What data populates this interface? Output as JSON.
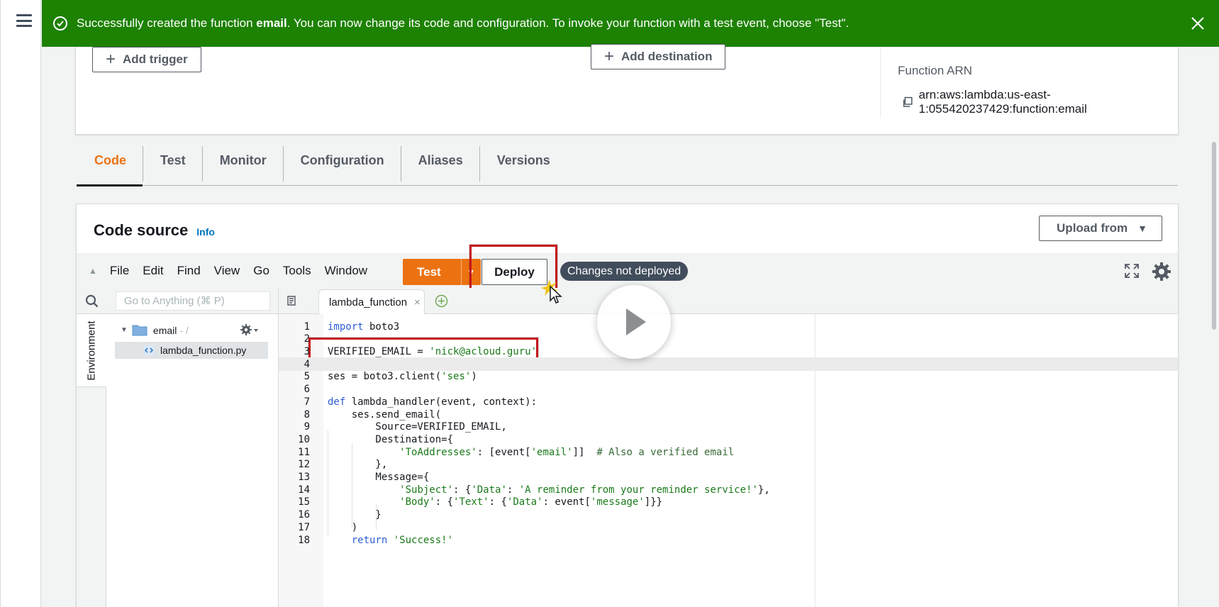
{
  "flash": {
    "prefix": "Successfully created the function ",
    "function_name": "email",
    "suffix": ". You can now change its code and configuration. To invoke your function with a test event, choose \"Test\"."
  },
  "overview": {
    "add_trigger": "Add trigger",
    "add_destination": "Add destination",
    "arn_label": "Function ARN",
    "arn_value": "arn:aws:lambda:us-east-1:055420237429:function:email"
  },
  "tabs": [
    {
      "label": "Code",
      "active": true
    },
    {
      "label": "Test"
    },
    {
      "label": "Monitor"
    },
    {
      "label": "Configuration"
    },
    {
      "label": "Aliases"
    },
    {
      "label": "Versions"
    }
  ],
  "code_source": {
    "title": "Code source",
    "info": "Info",
    "upload_from": "Upload from"
  },
  "ide": {
    "menu": [
      "File",
      "Edit",
      "Find",
      "View",
      "Go",
      "Tools",
      "Window"
    ],
    "test_label": "Test",
    "deploy_label": "Deploy",
    "changes_badge": "Changes not deployed",
    "search_placeholder": "Go to Anything (⌘ P)",
    "environment_tab": "Environment",
    "folder_name": "email",
    "folder_suffix": "- /",
    "file_name": "lambda_function.py",
    "open_tab": "lambda_function"
  },
  "code_lines": [
    "import boto3",
    "",
    "VERIFIED_EMAIL = 'nick@acloud.guru'",
    "",
    "ses = boto3.client('ses')",
    "",
    "def lambda_handler(event, context):",
    "    ses.send_email(",
    "        Source=VERIFIED_EMAIL,",
    "        Destination={",
    "            'ToAddresses': [event['email']]  # Also a verified email",
    "        },",
    "        Message={",
    "            'Subject': {'Data': 'A reminder from your reminder service!'},",
    "            'Body': {'Text': {'Data': event['message']}}",
    "        }",
    "    )",
    "    return 'Success!'"
  ],
  "colors": {
    "accent_orange": "#ec7211",
    "success_green": "#1d8102",
    "highlight_red": "#c4161c"
  }
}
